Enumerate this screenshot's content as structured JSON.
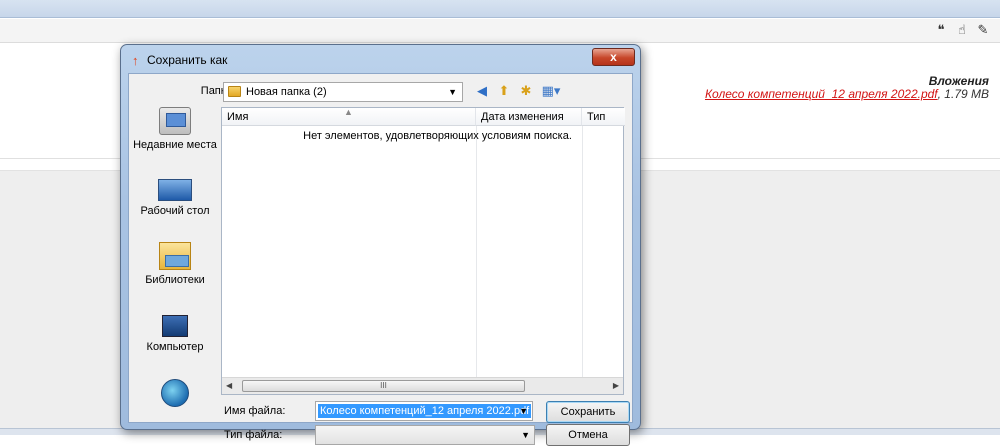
{
  "background": {
    "attachments_title": "Вложения",
    "attachment_link": "Колесо компетенций_12 апреля 2022.pdf",
    "attachment_size": ", 1.79 MB",
    "tool_icons": [
      "quote-icon",
      "cursor-icon",
      "pencil-icon"
    ],
    "tool_glyphs": [
      "❝",
      "☝",
      "✎"
    ]
  },
  "dialog": {
    "title": "Сохранить как",
    "close_label": "x",
    "folder_label": "Папка:",
    "folder_value": "Новая папка (2)",
    "places": [
      "Недавние места",
      "Рабочий стол",
      "Библиотеки",
      "Компьютер",
      "Сеть"
    ],
    "columns": [
      "Имя",
      "Дата изменения",
      "Тип"
    ],
    "empty_message": "Нет элементов, удовлетворяющих условиям поиска.",
    "filename_label": "Имя файла:",
    "filename_value": "Колесо компетенций_12 апреля 2022.pdf",
    "filetype_label": "Тип файла:",
    "filetype_value": "",
    "save_label": "Сохранить",
    "cancel_label": "Отмена",
    "scroll_grip": "III"
  },
  "colors": {
    "link": "#d21414",
    "selection": "#3399ff",
    "close_button": "#c7472a"
  }
}
